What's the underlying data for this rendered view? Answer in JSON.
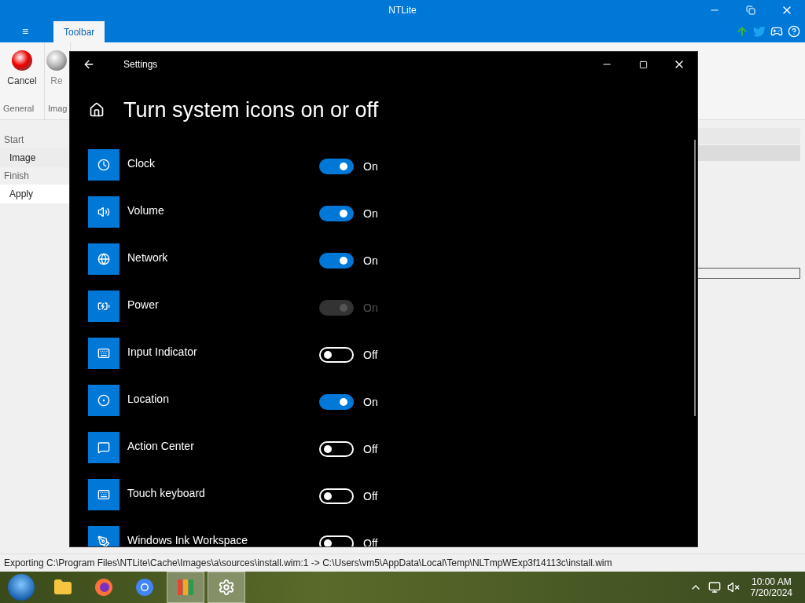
{
  "app_window": {
    "title": "NTLite",
    "menu_icon": "≡",
    "tabs": [
      {
        "label": "Toolbar",
        "selected": true
      }
    ],
    "ribbon": {
      "buttons": [
        {
          "label": "Cancel",
          "kind": "cancel"
        },
        {
          "label": "Re",
          "kind": "disabled"
        }
      ],
      "groups": [
        "General",
        "Imag"
      ]
    },
    "sidebar": [
      {
        "label": "Start",
        "kind": "header"
      },
      {
        "label": "Image",
        "kind": "item",
        "selected": false
      },
      {
        "label": "Finish",
        "kind": "header"
      },
      {
        "label": "Apply",
        "kind": "item",
        "selected": true
      }
    ],
    "status_bar": "Exporting C:\\Program Files\\NTLite\\Cache\\Images\\a\\sources\\install.wim:1 -> C:\\Users\\vm5\\AppData\\Local\\Temp\\NLTmpWExp3f14113c\\install.wim"
  },
  "settings_window": {
    "title": "Settings",
    "heading": "Turn system icons on or off",
    "items": [
      {
        "name": "Clock",
        "kind": "clock",
        "on": true,
        "disabled": false,
        "state": "On"
      },
      {
        "name": "Volume",
        "kind": "volume",
        "on": true,
        "disabled": false,
        "state": "On"
      },
      {
        "name": "Network",
        "kind": "network",
        "on": true,
        "disabled": false,
        "state": "On"
      },
      {
        "name": "Power",
        "kind": "power",
        "on": true,
        "disabled": true,
        "state": "On"
      },
      {
        "name": "Input Indicator",
        "kind": "keyboard",
        "on": false,
        "disabled": false,
        "state": "Off"
      },
      {
        "name": "Location",
        "kind": "location",
        "on": true,
        "disabled": false,
        "state": "On"
      },
      {
        "name": "Action Center",
        "kind": "message",
        "on": false,
        "disabled": false,
        "state": "Off"
      },
      {
        "name": "Touch keyboard",
        "kind": "keyboard",
        "on": false,
        "disabled": false,
        "state": "Off"
      },
      {
        "name": "Windows Ink Workspace",
        "kind": "pen",
        "on": false,
        "disabled": false,
        "state": "Off"
      }
    ]
  },
  "taskbar": {
    "apps": [
      {
        "kind": "folder",
        "selected": false
      },
      {
        "kind": "firefox",
        "selected": false
      },
      {
        "kind": "chrome",
        "selected": false
      },
      {
        "kind": "ntlite",
        "selected": true
      },
      {
        "kind": "settings",
        "selected": true
      }
    ],
    "time": "10:00 AM",
    "date": "7/20/2024"
  }
}
